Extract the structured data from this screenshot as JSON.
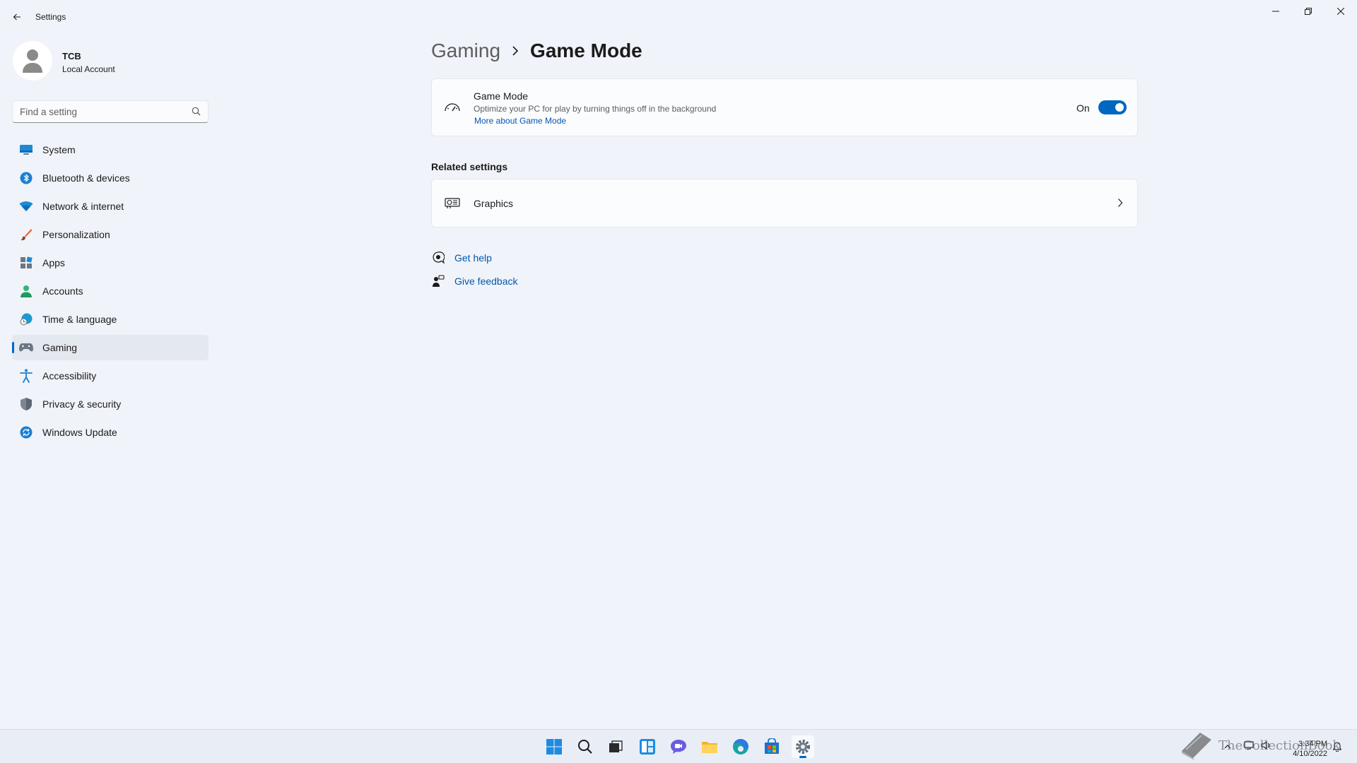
{
  "window": {
    "title": "Settings"
  },
  "profile": {
    "name": "TCB",
    "account_type": "Local Account"
  },
  "search": {
    "placeholder": "Find a setting"
  },
  "sidebar": {
    "items": [
      {
        "label": "System",
        "icon": "monitor-icon"
      },
      {
        "label": "Bluetooth & devices",
        "icon": "bluetooth-icon"
      },
      {
        "label": "Network & internet",
        "icon": "wifi-icon"
      },
      {
        "label": "Personalization",
        "icon": "brush-icon"
      },
      {
        "label": "Apps",
        "icon": "apps-icon"
      },
      {
        "label": "Accounts",
        "icon": "person-icon"
      },
      {
        "label": "Time & language",
        "icon": "globe-clock-icon"
      },
      {
        "label": "Gaming",
        "icon": "gamepad-icon",
        "active": true
      },
      {
        "label": "Accessibility",
        "icon": "accessibility-icon"
      },
      {
        "label": "Privacy & security",
        "icon": "shield-icon"
      },
      {
        "label": "Windows Update",
        "icon": "update-icon"
      }
    ]
  },
  "breadcrumb": {
    "parent": "Gaming",
    "current": "Game Mode"
  },
  "game_mode": {
    "title": "Game Mode",
    "description": "Optimize your PC for play by turning things off in the background",
    "link": "More about Game Mode",
    "toggle_label": "On",
    "toggle_on": true
  },
  "related": {
    "title": "Related settings",
    "items": [
      {
        "label": "Graphics"
      }
    ]
  },
  "help": {
    "get_help": "Get help",
    "give_feedback": "Give feedback"
  },
  "taskbar": {
    "apps": [
      "start-icon",
      "search-icon",
      "task-view-icon",
      "widgets-icon",
      "chat-icon",
      "file-explorer-icon",
      "edge-icon",
      "store-icon",
      "settings-icon"
    ],
    "time": "3:34 PM",
    "date": "4/10/2022"
  },
  "watermark": {
    "text": "TheCollectionBook"
  },
  "colors": {
    "accent": "#0067c0",
    "link": "#0058b0",
    "background": "#f0f3f9"
  }
}
